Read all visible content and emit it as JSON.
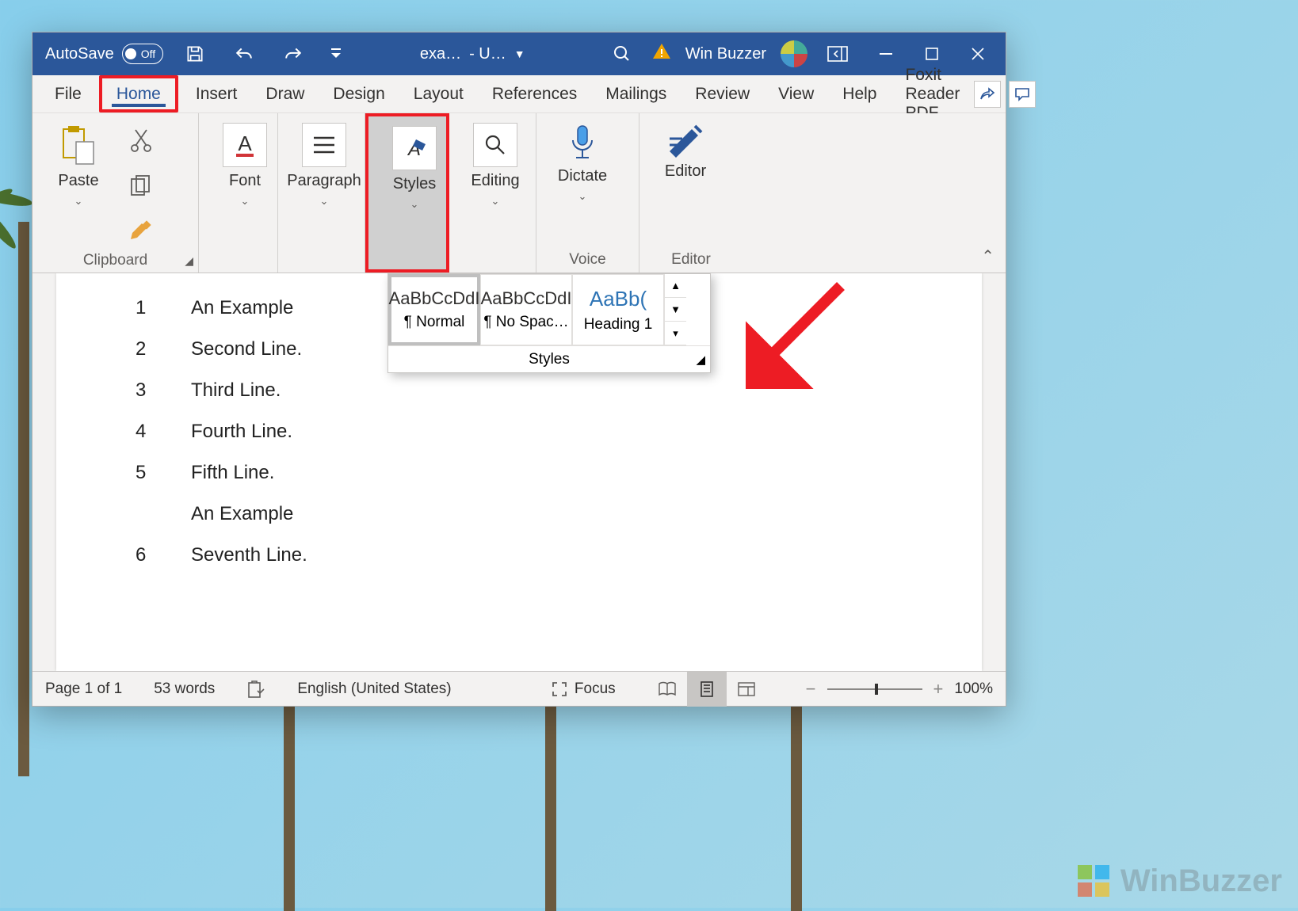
{
  "titlebar": {
    "autosave_label": "AutoSave",
    "autosave_state": "Off",
    "doc_title_left": "exa…",
    "doc_title_right": "- U…",
    "username": "Win Buzzer"
  },
  "tabs": {
    "file": "File",
    "home": "Home",
    "insert": "Insert",
    "draw": "Draw",
    "design": "Design",
    "layout": "Layout",
    "references": "References",
    "mailings": "Mailings",
    "review": "Review",
    "view": "View",
    "help": "Help",
    "foxit": "Foxit Reader PDF"
  },
  "ribbon": {
    "clipboard": {
      "paste": "Paste",
      "label": "Clipboard"
    },
    "font": {
      "label": "Font"
    },
    "paragraph": {
      "label": "Paragraph"
    },
    "styles": {
      "label": "Styles"
    },
    "editing": {
      "label": "Editing"
    },
    "voice": {
      "dictate": "Dictate",
      "label": "Voice"
    },
    "editor": {
      "editor": "Editor",
      "label": "Editor"
    }
  },
  "styles_gallery": {
    "preview_text": "AaBbCcDdI",
    "heading_preview": "AaBb(",
    "items": [
      {
        "name": "¶ Normal"
      },
      {
        "name": "¶ No Spac…"
      },
      {
        "name": "Heading 1"
      }
    ],
    "label": "Styles"
  },
  "document": {
    "lines": [
      {
        "num": "1",
        "text": "An Example"
      },
      {
        "num": "2",
        "text": "Second Line."
      },
      {
        "num": "3",
        "text": "Third Line."
      },
      {
        "num": "4",
        "text": "Fourth Line."
      },
      {
        "num": "5",
        "text": "Fifth Line."
      },
      {
        "num": "",
        "text": "An Example"
      },
      {
        "num": "6",
        "text": "Seventh Line."
      }
    ]
  },
  "statusbar": {
    "page": "Page 1 of 1",
    "words": "53 words",
    "language": "English (United States)",
    "focus": "Focus",
    "zoom": "100%"
  },
  "watermark": "WinBuzzer"
}
